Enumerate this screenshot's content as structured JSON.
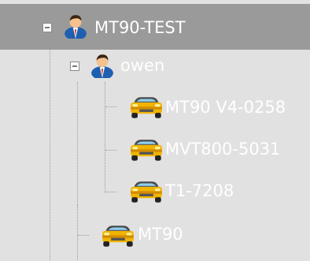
{
  "tree": {
    "root": {
      "label": "MT90-TEST",
      "icon": "user-icon",
      "expanded": true,
      "selected": true
    },
    "user": {
      "label": "owen",
      "icon": "user-icon",
      "expanded": true
    },
    "vehicles": [
      {
        "label": "MT90 V4-0258",
        "icon": "car-icon"
      },
      {
        "label": "MVT800-5031",
        "icon": "car-icon"
      },
      {
        "label": "T1-7208",
        "icon": "car-icon"
      }
    ],
    "root_vehicle": {
      "label": "MT90",
      "icon": "car-icon"
    }
  },
  "colors": {
    "background": "#e1e1e1",
    "selected_row": "#9a9a9a",
    "text": "#ffffff",
    "guide_lines": "#9d9d9d"
  }
}
